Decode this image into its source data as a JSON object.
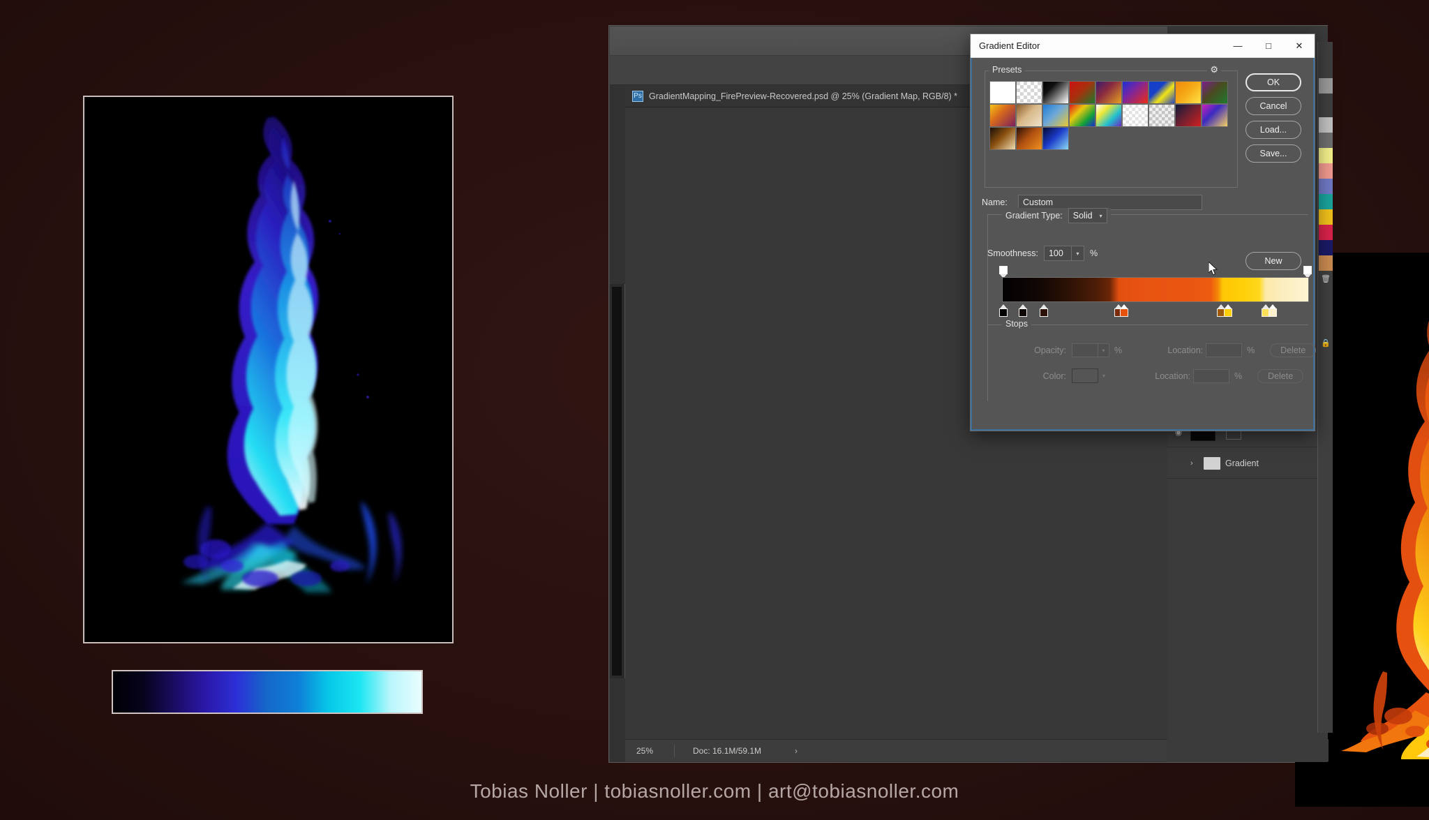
{
  "footer": {
    "credit": "Tobias Noller  |  tobiasnoller.com  |  art@tobiasnoller.com"
  },
  "left_preview": {
    "label": "blue-flame-preview",
    "swatch_label": "blue-gradient-swatch",
    "gradient_stops": [
      "#000006",
      "#07031c",
      "#1b0c63",
      "#2a18a8",
      "#2c2fd6",
      "#1468c8",
      "#0f7fd8",
      "#07c8e8",
      "#1ce6f2",
      "#b9f6fb",
      "#e9feff"
    ]
  },
  "photoshop": {
    "document_tab": {
      "title": "GradientMapping_FirePreview-Recovered.psd @ 25% (Gradient Map, RGB/8) *",
      "icon": "psd-file-icon",
      "close_label": "×"
    },
    "status_bar": {
      "zoom": "25%",
      "doc_info": "Doc: 16.1M/59.1M",
      "arrow": "›"
    },
    "layers": [
      {
        "name": "",
        "type": "adjustment",
        "eye": "◉",
        "thumb": "black-thumb"
      },
      {
        "name": "Gradient",
        "type": "group",
        "chevron": "›",
        "icon": "folder-icon"
      }
    ]
  },
  "gradient_editor": {
    "title": "Gradient Editor",
    "window_buttons": {
      "minimize": "—",
      "maximize": "□",
      "close": "✕"
    },
    "presets": {
      "legend": "Presets",
      "gear": "⚙",
      "swatches": [
        [
          "#ffffff|#ffffff",
          "checker",
          "#000000|#ffffff",
          "#cc1111|#1d7a2a",
          "#3a1d6e|#e8a020",
          "#1b2fd6|#ee2b12",
          "#1640c8|#f3e414",
          "#f08a10|#ffe24a",
          "#7a1d8e|#1e7a2e"
        ],
        [
          "#f5c21a|#7a2060",
          "#8a5a2a|#f0e2cc",
          "#1a7ad6|#e8c830",
          "#e01818|#12a038",
          "#ffffff|#22c0d0",
          "checker-light",
          "checker-gray",
          "#101838|#d02020",
          "#d020c0|#f5d060"
        ],
        [
          "#1a0e08|#f0dcb0",
          "#2a1008|#f09020",
          "#080a30|#8ad8f5"
        ]
      ]
    },
    "buttons": {
      "ok": "OK",
      "cancel": "Cancel",
      "load": "Load...",
      "save": "Save...",
      "new": "New"
    },
    "name": {
      "label": "Name:",
      "value": "Custom"
    },
    "gradient_type": {
      "label": "Gradient Type:",
      "value": "Solid",
      "caret": "▾"
    },
    "smoothness": {
      "label": "Smoothness:",
      "value": "100",
      "unit": "%",
      "caret": "▾"
    },
    "gradient_bar": {
      "css": "linear-gradient(to right, #030202 0%, #0b0503 8%, #150804 13%, #2e1205 22%, #4a1c06 30%, #6a2507 35%, #e2500f 38%, #e85311 45%, #ea5612 60%, #ec5a10 68%, #f58a07 70.5%, #fec706 72%, #ffcf07 78%, #ffd81d 84%, #fbe9a8 86%, #fbeec0 92%, #fdf4d2 100%)",
      "opacity_stops": [
        {
          "pos": 0,
          "color": "#ffffff"
        },
        {
          "pos": 100,
          "color": "#ffffff"
        }
      ],
      "color_stops": [
        {
          "pos": 0,
          "color": "#000000",
          "pair": false
        },
        {
          "pos": 6,
          "color": "#0d0603",
          "pair": false
        },
        {
          "pos": 13,
          "color": "#2c1206",
          "pair": false
        },
        {
          "pos": 37.5,
          "color": "#7a2c08",
          "pair": true,
          "color2": "#e8520f"
        },
        {
          "pos": 71,
          "color": "#a05a06",
          "pair": true,
          "color2": "#ffcf07"
        },
        {
          "pos": 85.5,
          "color": "#fbe05a",
          "pair": true,
          "color2": "#fdf2cc"
        }
      ]
    },
    "stops": {
      "legend": "Stops",
      "opacity_label": "Opacity:",
      "opacity_value": "",
      "opacity_unit": "%",
      "opacity_location_label": "Location:",
      "opacity_location_value": "",
      "opacity_location_unit": "%",
      "opacity_delete": "Delete",
      "color_label": "Color:",
      "color_value": "",
      "color_location_label": "Location:",
      "color_location_value": "",
      "color_location_unit": "%",
      "color_delete": "Delete"
    }
  },
  "swatch_strip": {
    "name": "color-swatches-strip",
    "colors": [
      "#9a9a9a",
      "#a8a8a8",
      "#c9c9c9",
      "#6e6e6e",
      "#f2ef8a",
      "#f0998f",
      "#6f78c4",
      "#1aa39b",
      "#f0c01a",
      "#d8224a",
      "#1a1a66",
      "#c98a50"
    ],
    "icons": [
      "trash-icon",
      "lock-icon"
    ]
  }
}
